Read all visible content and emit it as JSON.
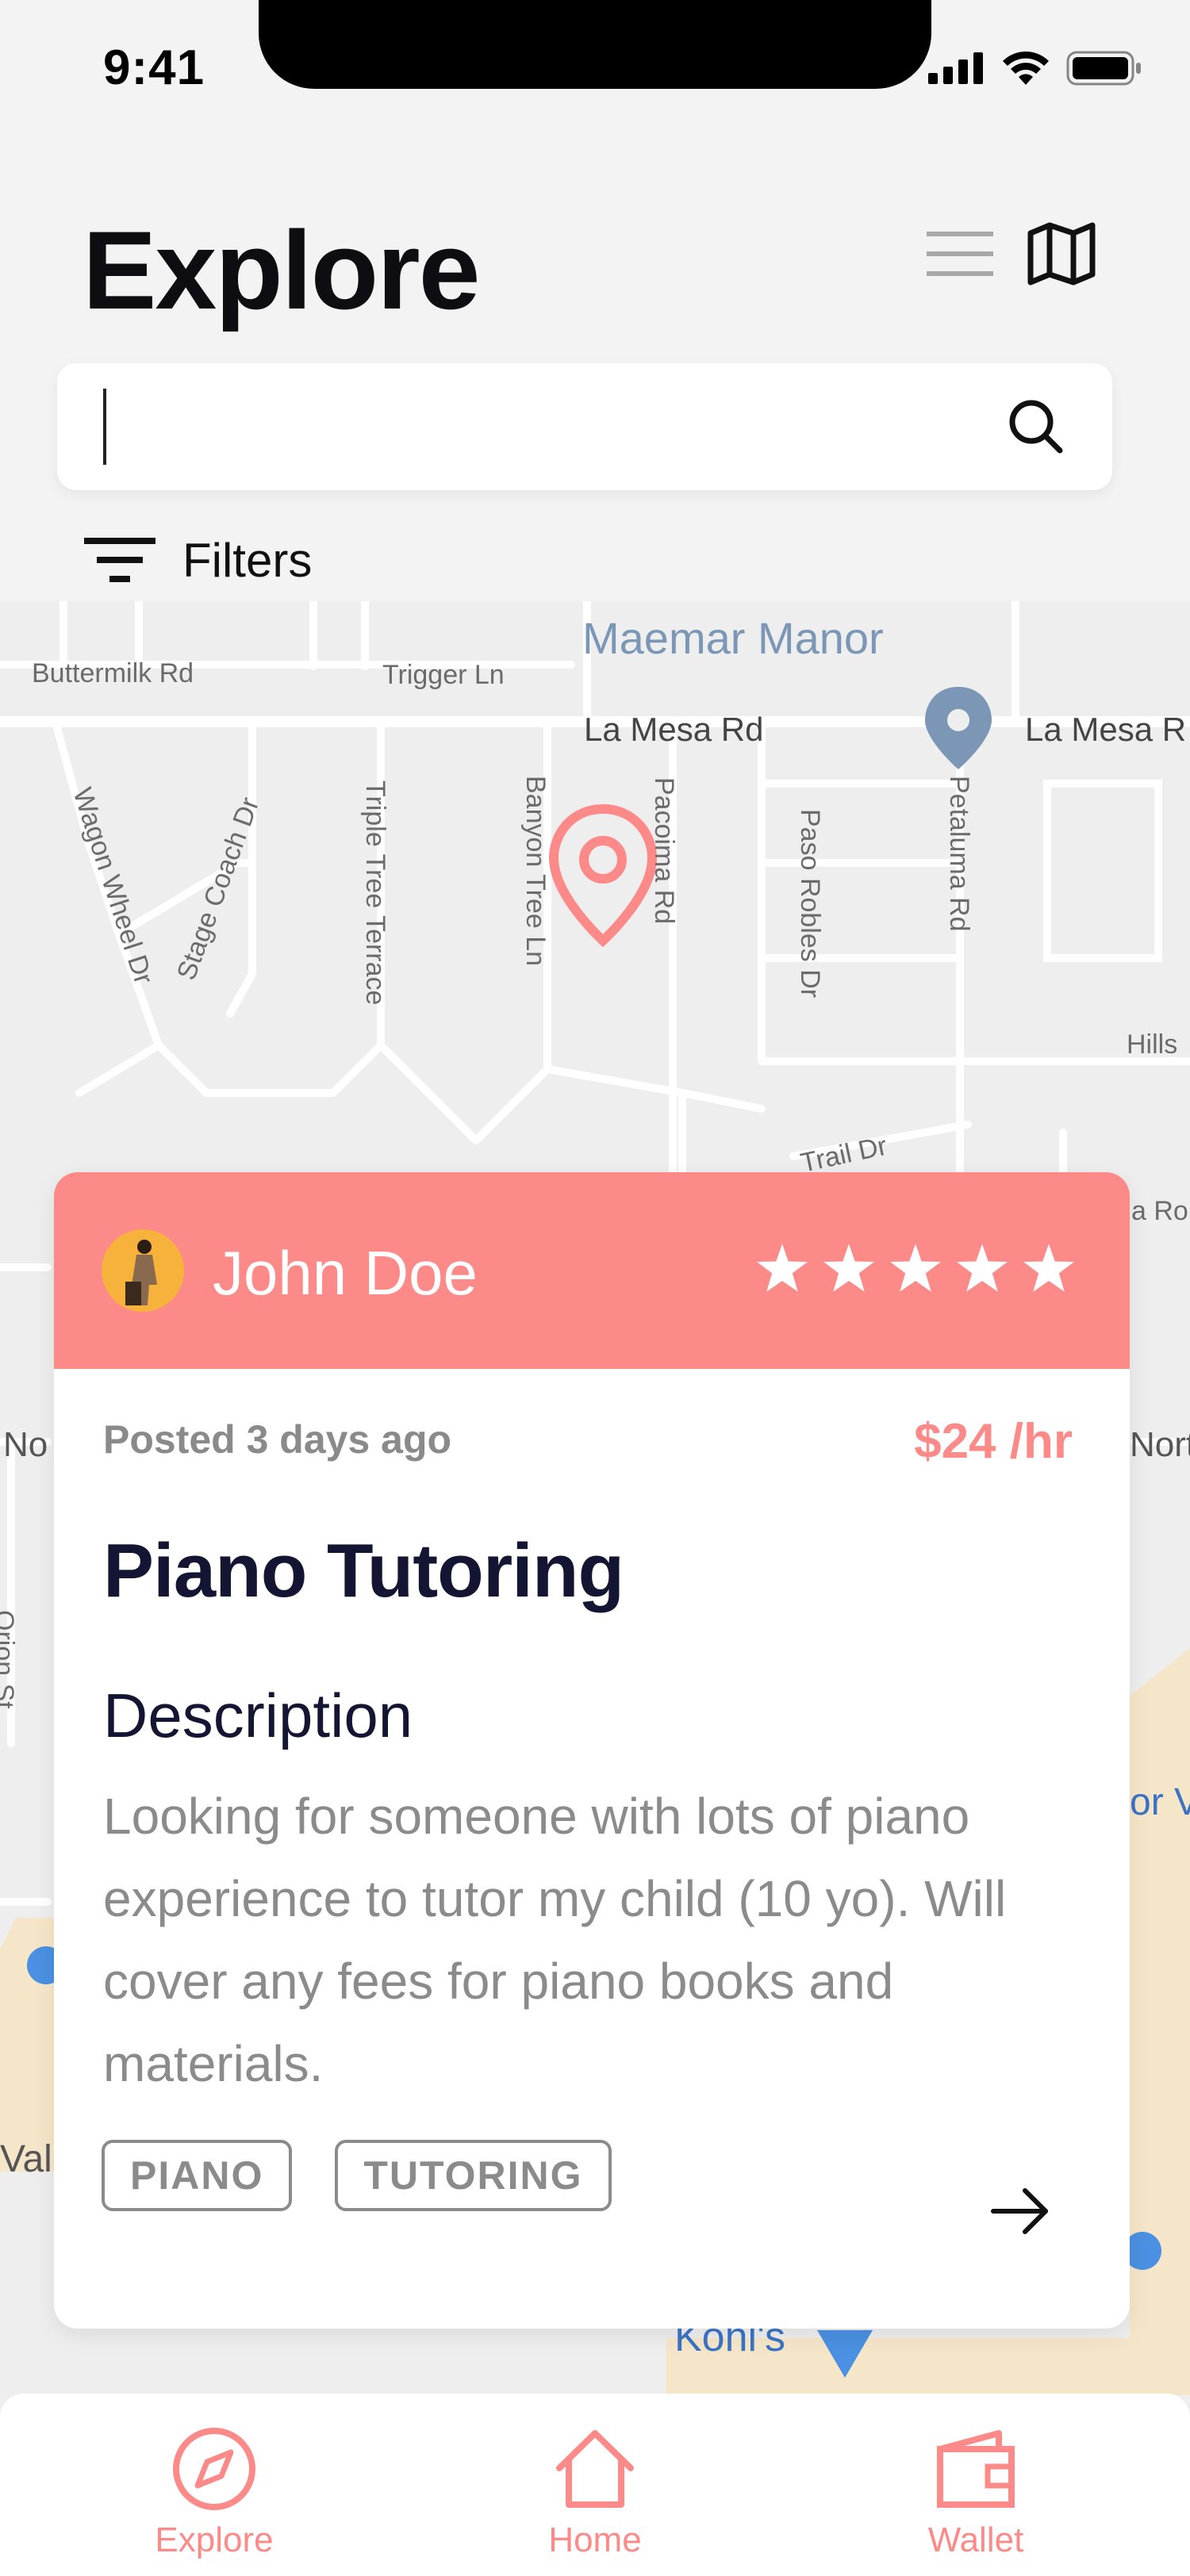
{
  "status_bar": {
    "time": "9:41"
  },
  "header": {
    "title": "Explore",
    "search_placeholder": "",
    "filters_label": "Filters"
  },
  "map": {
    "streets": [
      "Buttermilk Rd",
      "Trigger Ln",
      "Maemar Manor",
      "La Mesa Rd",
      "La Mesa R",
      "Wagon Wheel Dr",
      "Stage Coach Dr",
      "Triple Tree Terrace",
      "Banyon Tree Ln",
      "Pacoima Rd",
      "Paso Robles Dr",
      "Petaluma Rd",
      "Hills",
      "Trail Dr",
      "a Ro",
      "No",
      "Nort",
      "Orion St",
      "Kohl's",
      "Valg",
      "or V"
    ]
  },
  "job_card": {
    "poster_name": "John Doe",
    "rating": 5,
    "posted": "Posted 3 days ago",
    "price": "$24 /hr",
    "title": "Piano Tutoring",
    "description_label": "Description",
    "description": "Looking for someone with lots of piano experience to tutor my child (10 yo). Will cover any fees for piano books and materials.",
    "tags": [
      "PIANO",
      "TUTORING"
    ]
  },
  "tab_bar": {
    "tabs": [
      {
        "label": "Explore",
        "icon": "compass-icon"
      },
      {
        "label": "Home",
        "icon": "home-icon"
      },
      {
        "label": "Wallet",
        "icon": "wallet-icon"
      }
    ]
  },
  "colors": {
    "accent": "#fc8a88",
    "title": "#141433",
    "muted": "#8b8b8b"
  }
}
